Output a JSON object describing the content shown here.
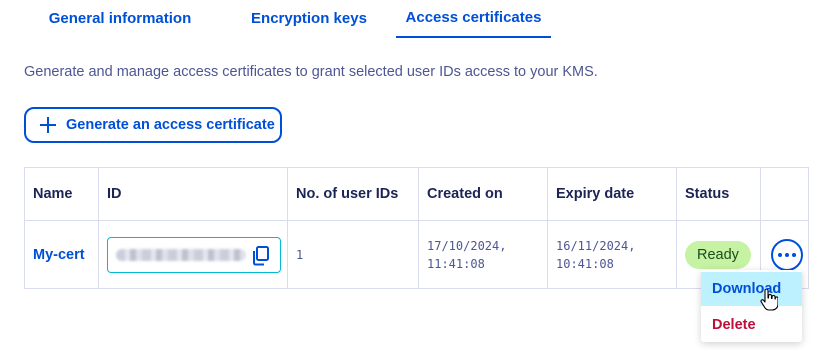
{
  "tabs": [
    {
      "label": "General information"
    },
    {
      "label": "Encryption keys"
    },
    {
      "label": "Access certificates",
      "active": true
    }
  ],
  "description": "Generate and manage access certificates to grant selected user IDs access to your KMS.",
  "generate_button": {
    "label": "Generate an access certificate",
    "icon": "plus-icon"
  },
  "table": {
    "headers": [
      "Name",
      "ID",
      "No. of user IDs",
      "Created on",
      "Expiry date",
      "Status"
    ],
    "rows": [
      {
        "name": "My-cert",
        "user_ids": "1",
        "created_on_date": "17/10/2024,",
        "created_on_time": "11:41:08",
        "expiry_date": "16/11/2024,",
        "expiry_time": "10:41:08",
        "status": "Ready"
      }
    ]
  },
  "actions_menu": {
    "download": "Download",
    "delete": "Delete"
  },
  "colors": {
    "primary": "#0050d7",
    "text": "#4d5693",
    "heading": "#1c2455",
    "border": "#d9dcee",
    "status_ready_bg": "#c5f2a3",
    "menu_hover_bg": "#bef1ff",
    "danger": "#bd0f3a",
    "id_border": "#00bbd4"
  }
}
